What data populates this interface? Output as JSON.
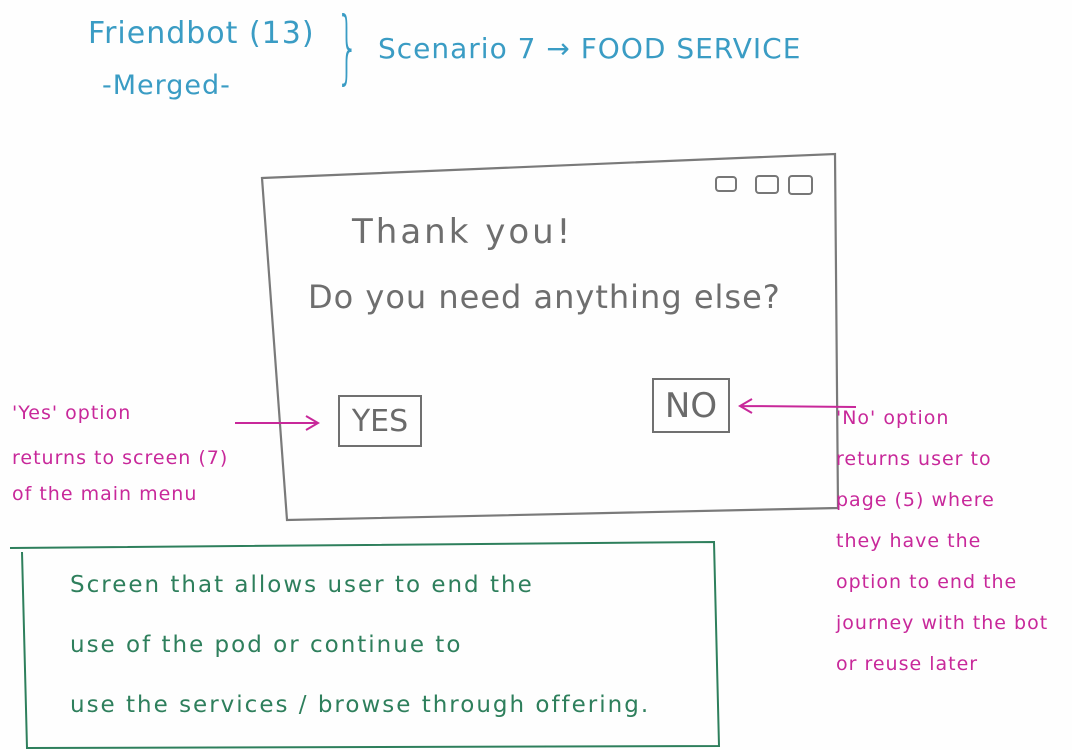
{
  "header": {
    "line1": "Friendbot (13)",
    "line2": "-Merged-",
    "scenario": "Scenario 7 → FOOD SERVICE"
  },
  "screen": {
    "line1": "Thank you!",
    "line2": "Do you need anything else?",
    "yes_label": "YES",
    "no_label": "NO",
    "window_icons": [
      "window-control-icon",
      "window-control-icon",
      "window-control-icon"
    ]
  },
  "annotations": {
    "yes_note": [
      "'Yes' option",
      "returns to screen (7)",
      "of the main menu"
    ],
    "no_note": [
      "'No' option",
      "returns user to",
      "page (5) where",
      "they have the",
      "option to end the",
      "journey with the bot",
      "or reuse later"
    ],
    "description": [
      "Screen that allows user to end the",
      "use of the pod or continue to",
      "use the services / browse through offering."
    ]
  },
  "colors": {
    "header": "#3a9cc4",
    "screen": "#6e6e6e",
    "annotation": "#c8289a",
    "description": "#2e7f5c"
  }
}
